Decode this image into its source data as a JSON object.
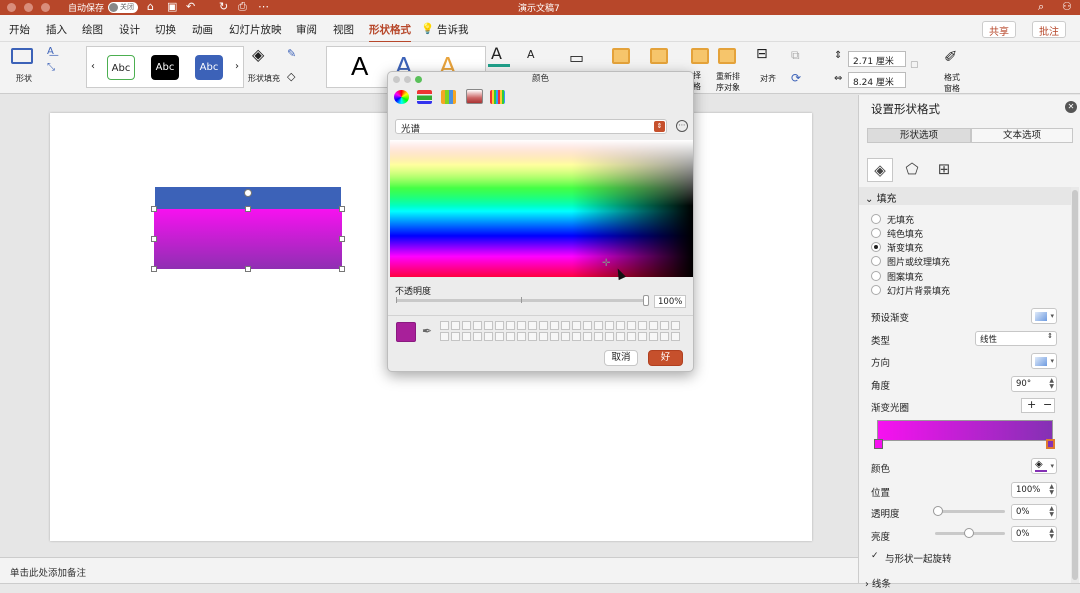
{
  "titlebar": {
    "autosave_label": "自动保存",
    "autosave_state": "关闭",
    "doc_title": "演示文稿7"
  },
  "tabs": [
    {
      "label": "开始"
    },
    {
      "label": "插入"
    },
    {
      "label": "绘图"
    },
    {
      "label": "设计"
    },
    {
      "label": "切换"
    },
    {
      "label": "动画"
    },
    {
      "label": "幻灯片放映"
    },
    {
      "label": "审阅"
    },
    {
      "label": "视图"
    },
    {
      "label": "形状格式",
      "active": true
    },
    {
      "label": "告诉我"
    }
  ],
  "header_buttons": {
    "share": "共享",
    "comment": "批注"
  },
  "ribbon": {
    "shapes_label": "形状",
    "style_abc": "Abc",
    "shape_fill_label": "形状填充",
    "big_a": "A",
    "select_pane_label": "选择\n窗格",
    "reorder_label": "重新排\n序对象",
    "align_label": "对齐",
    "height_value": "2.71 厘米",
    "width_value": "8.24 厘米",
    "format_pane_label": "格式\n窗格"
  },
  "notes": {
    "placeholder": "单击此处添加备注"
  },
  "color_dialog": {
    "title": "颜色",
    "mode": "光谱",
    "opacity_label": "不透明度",
    "opacity_value": "100%",
    "current_color": "#a8209a",
    "cancel": "取消",
    "ok": "好"
  },
  "format_pane": {
    "title": "设置形状格式",
    "tab_shape": "形状选项",
    "tab_text": "文本选项",
    "section_fill": "填充",
    "fill_options": [
      {
        "label": "无填充",
        "selected": false
      },
      {
        "label": "纯色填充",
        "selected": false
      },
      {
        "label": "渐变填充",
        "selected": true
      },
      {
        "label": "图片或纹理填充",
        "selected": false
      },
      {
        "label": "图案填充",
        "selected": false
      },
      {
        "label": "幻灯片背景填充",
        "selected": false
      }
    ],
    "preset_label": "预设渐变",
    "type_label": "类型",
    "type_value": "线性",
    "direction_label": "方向",
    "angle_label": "角度",
    "angle_value": "90°",
    "stops_label": "渐变光圈",
    "color_label": "颜色",
    "position_label": "位置",
    "position_value": "100%",
    "transparency_label": "透明度",
    "transparency_value": "0%",
    "brightness_label": "亮度",
    "brightness_value": "0%",
    "rotate_with_shape": "与形状一起旋转",
    "section_line": "线条",
    "gradient_start": "#f711f0",
    "gradient_end": "#8431b4"
  },
  "colors": {
    "accent": "#b7472a",
    "shape_top": "#3c62b8"
  }
}
